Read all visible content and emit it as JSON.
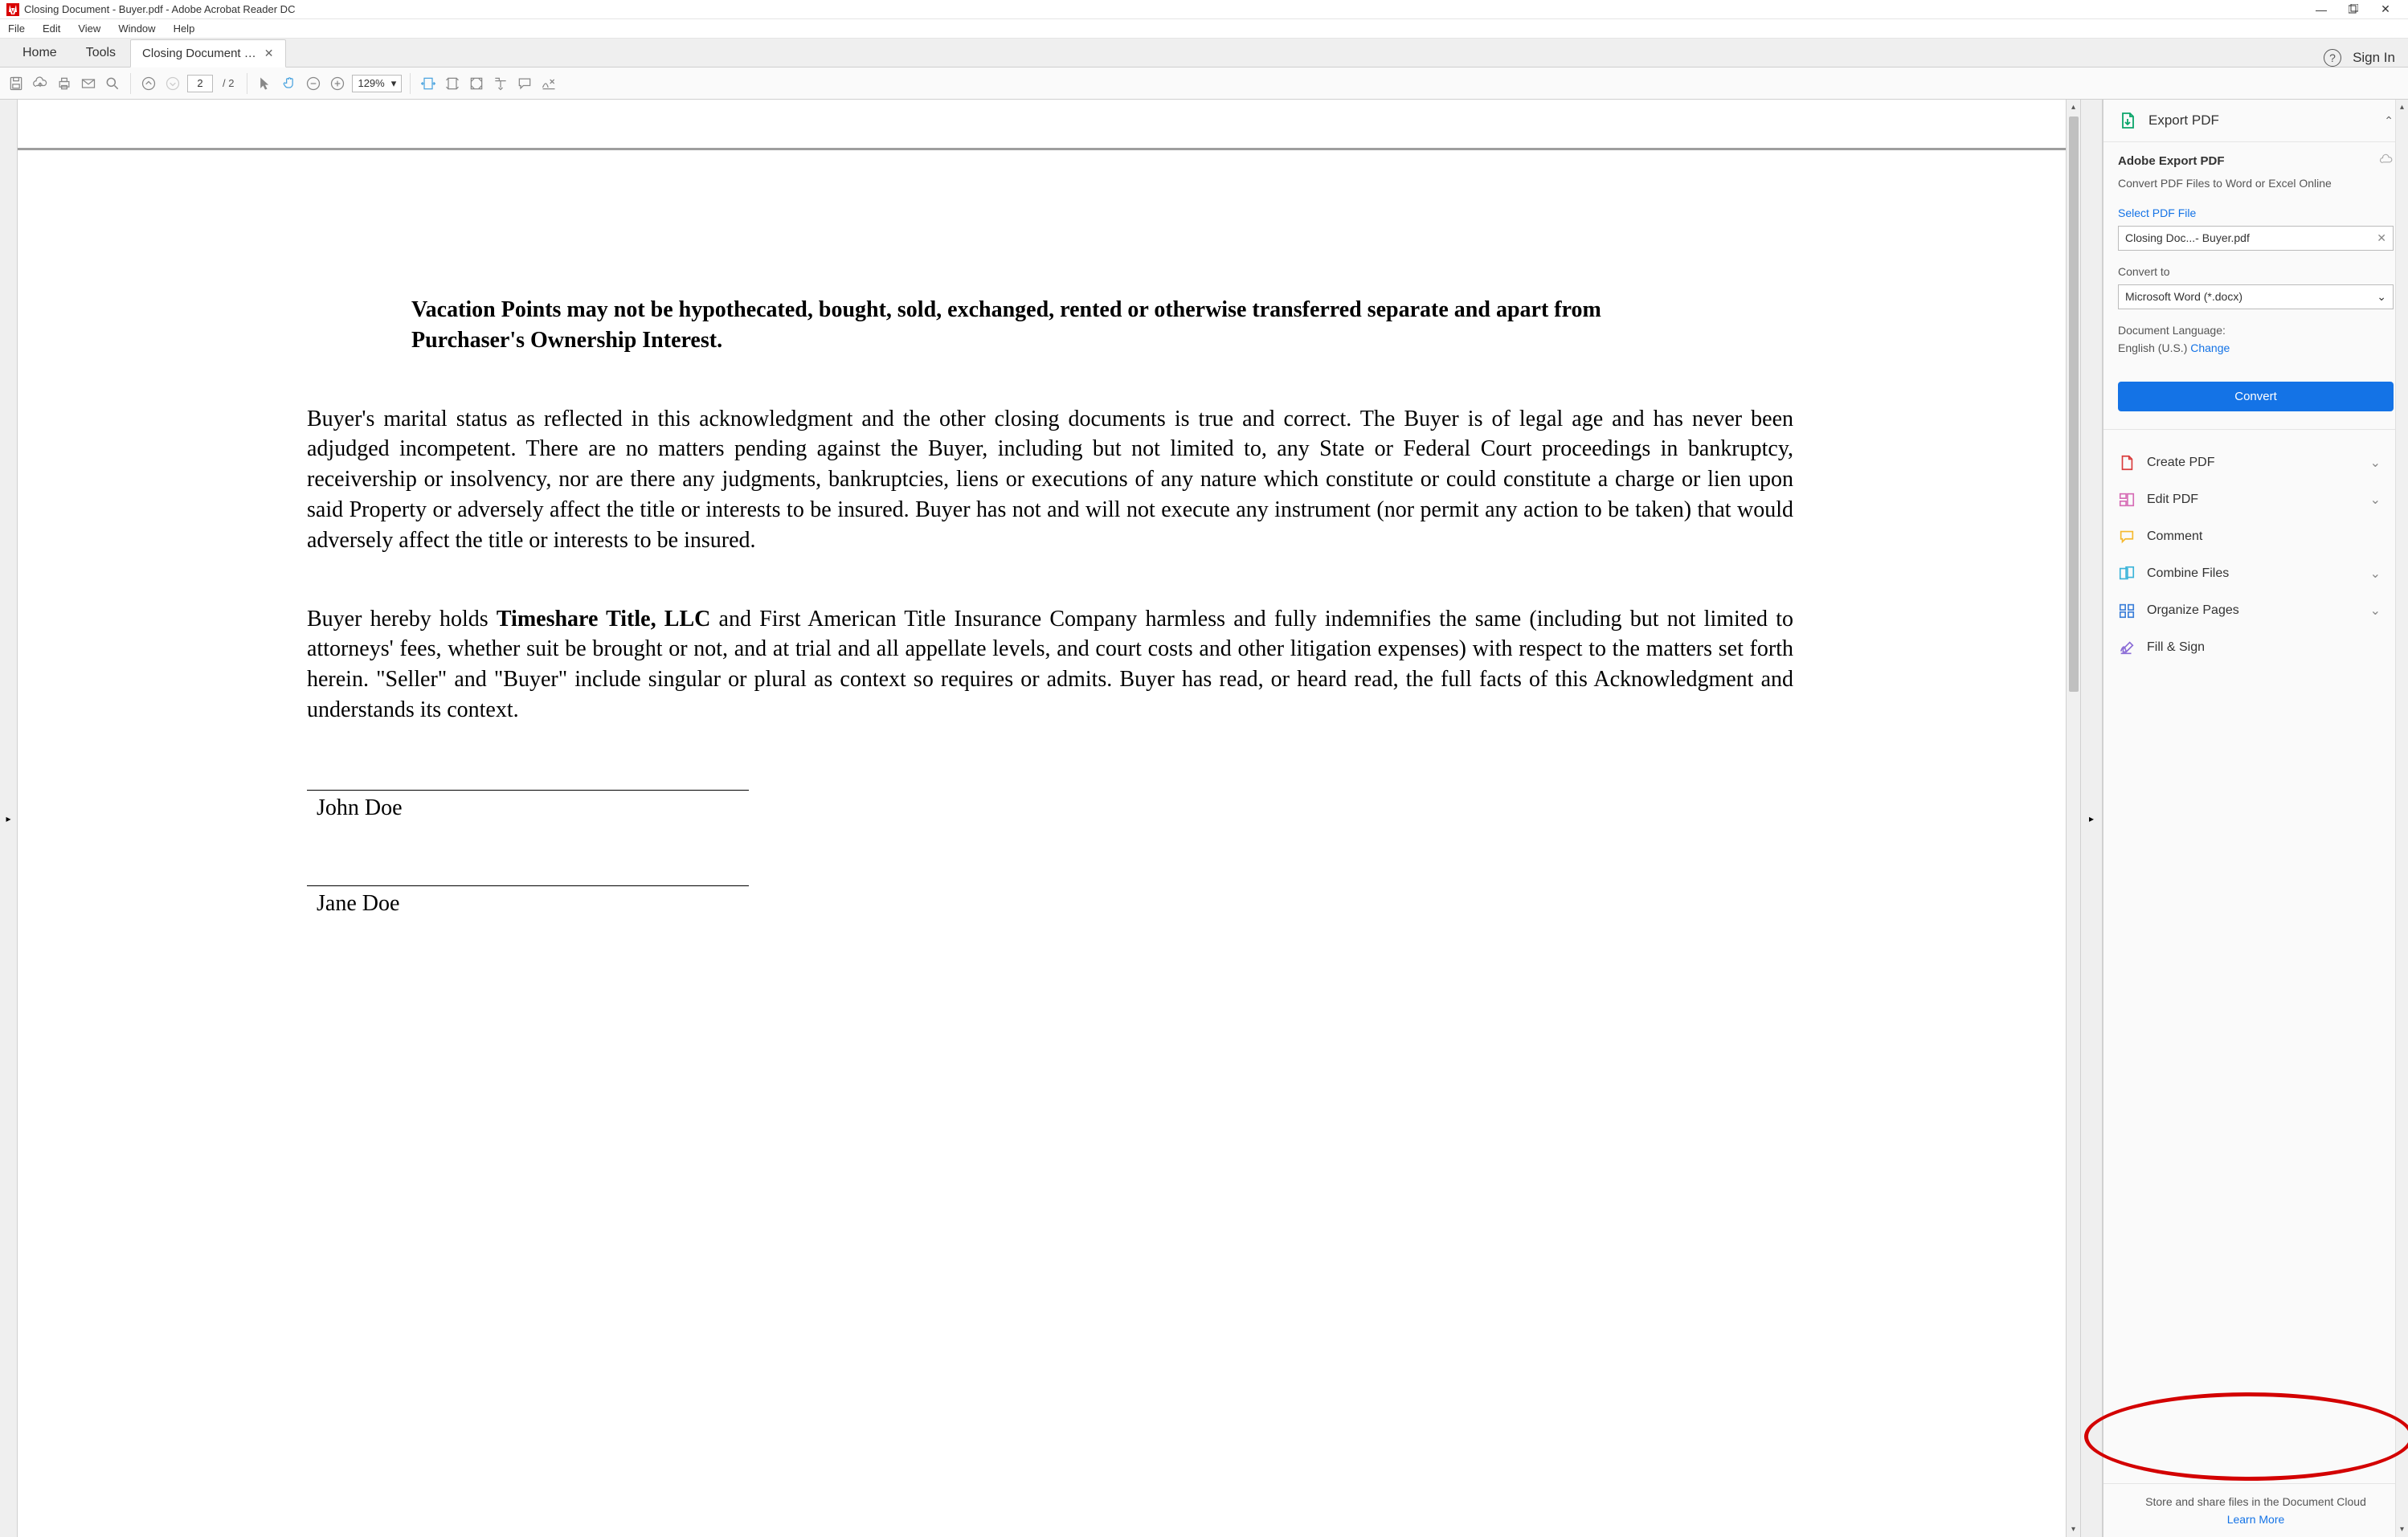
{
  "window": {
    "title": "Closing Document - Buyer.pdf - Adobe Acrobat Reader DC"
  },
  "menu": {
    "file": "File",
    "edit": "Edit",
    "view": "View",
    "window": "Window",
    "help": "Help"
  },
  "tabs": {
    "home": "Home",
    "tools": "Tools",
    "active": "Closing Document …",
    "help_icon": "?",
    "signin": "Sign In"
  },
  "toolbar": {
    "current_page": "2",
    "total_pages": "/ 2",
    "zoom": "129%"
  },
  "document": {
    "bold_para": "Vacation Points may not be hypothecated, bought, sold, exchanged, rented or otherwise transferred separate and apart from Purchaser's Ownership Interest.",
    "para1": "Buyer's marital status as reflected in this acknowledgment and the other closing documents is true and correct. The Buyer is of legal age and has never been adjudged incompetent. There are no matters pending against the Buyer, including but not limited to, any State or Federal Court proceedings in bankruptcy, receivership or insolvency, nor are there any judgments, bankruptcies, liens or executions of any nature which constitute or could constitute a charge or lien upon said Property or adversely affect the title or interests to be insured. Buyer has not and will not execute any instrument (nor permit any action to be taken) that would adversely affect the title or interests to be insured.",
    "para2_pre": "Buyer hereby holds ",
    "para2_bold": "Timeshare Title, LLC",
    "para2_post": " and First American Title Insurance Company harmless and fully indemnifies the same (including but not limited to attorneys' fees, whether suit be brought or not, and at trial and all appellate levels, and court costs and other litigation expenses) with respect to the matters set forth herein. \"Seller\" and \"Buyer\" include singular or plural as context so requires or admits. Buyer has read, or heard read, the full facts of this Acknowledgment and understands its context.",
    "sig1": "John Doe",
    "sig2": "Jane Doe"
  },
  "export": {
    "header": "Export PDF",
    "title": "Adobe Export PDF",
    "subtitle": "Convert PDF Files to Word or Excel Online",
    "select_label": "Select PDF File",
    "selected_file": "Closing Doc...- Buyer.pdf",
    "convert_to_label": "Convert to",
    "convert_to_value": "Microsoft Word (*.docx)",
    "doc_lang_label": "Document Language:",
    "doc_lang_value": "English (U.S.) ",
    "change": "Change",
    "convert_btn": "Convert"
  },
  "tools": {
    "create": "Create PDF",
    "edit": "Edit PDF",
    "comment": "Comment",
    "combine": "Combine Files",
    "organize": "Organize Pages",
    "fillsign": "Fill & Sign"
  },
  "footer": {
    "line": "Store and share files in the Document Cloud",
    "learn": "Learn More"
  }
}
